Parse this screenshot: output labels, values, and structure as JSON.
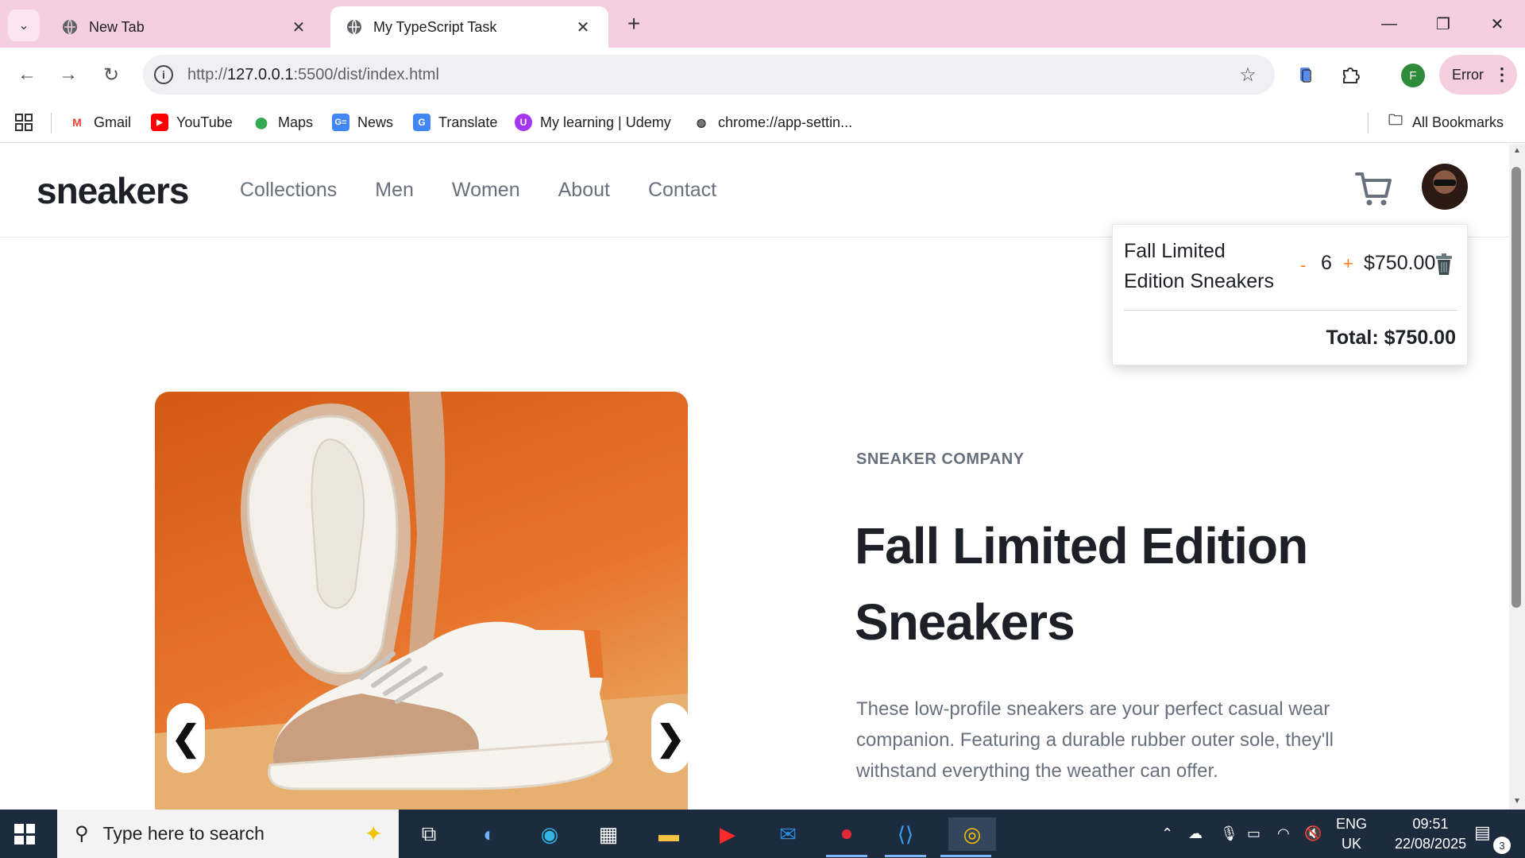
{
  "browser": {
    "tabs": [
      {
        "title": "New Tab",
        "active": false
      },
      {
        "title": "My TypeScript Task",
        "active": true
      }
    ],
    "url_prefix": "http://",
    "url_host": "127.0.0.1",
    "url_rest": ":5500/dist/index.html",
    "profile_initial": "F",
    "error_label": "Error",
    "bookmarks": [
      "Gmail",
      "YouTube",
      "Maps",
      "News",
      "Translate",
      "My learning | Udemy",
      "chrome://app-settin..."
    ],
    "all_bookmarks": "All Bookmarks"
  },
  "site": {
    "logo": "sneakers",
    "nav": [
      "Collections",
      "Men",
      "Women",
      "About",
      "Contact"
    ],
    "cart": {
      "item_name": "Fall Limited Edition Sneakers",
      "minus": "-",
      "quantity": "6",
      "plus": "+",
      "price": "$750.00",
      "total": "Total: $750.00"
    },
    "product": {
      "company": "SNEAKER COMPANY",
      "title": "Fall Limited Edition Sneakers",
      "description": "These low-profile sneakers are your perfect casual wear companion. Featuring a durable rubber outer sole, they'll withstand everything the weather can offer."
    },
    "gallery": {
      "prev": "❮",
      "next": "❯"
    }
  },
  "taskbar": {
    "search_placeholder": "Type here to search",
    "lang_line1": "ENG",
    "lang_line2": "UK",
    "time": "09:51",
    "date": "22/08/2025",
    "notification_count": "3"
  },
  "colors": {
    "accent": "#ff7d1a",
    "text_dark": "#1d2026",
    "text_gray": "#69707d",
    "tabbar": "#f5cfe0"
  }
}
